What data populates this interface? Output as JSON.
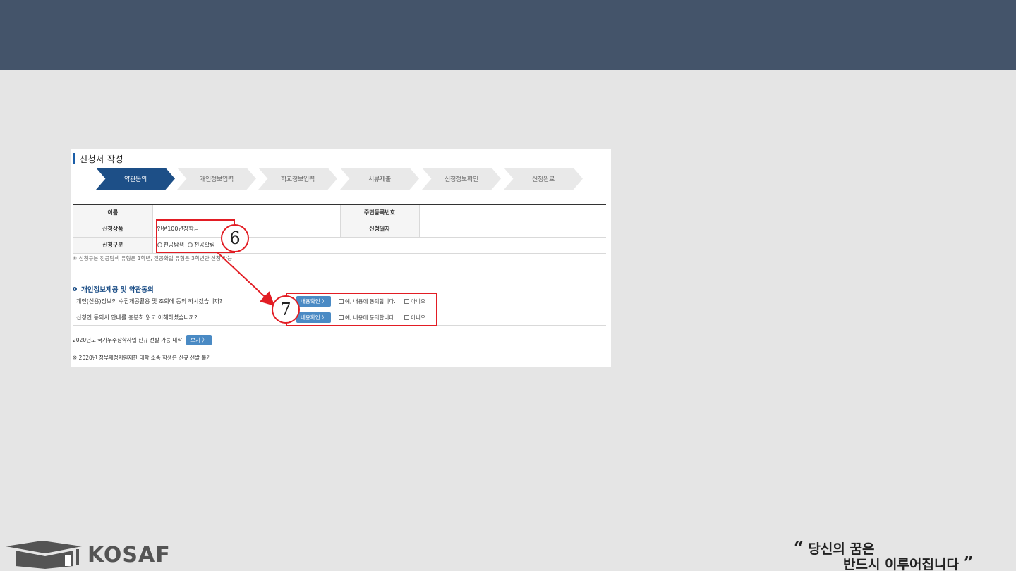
{
  "form": {
    "title": "신청서 작성",
    "steps": [
      "약관동의",
      "개인정보입력",
      "학교정보입력",
      "서류제출",
      "신청정보확인",
      "신청완료"
    ],
    "fields": {
      "name_label": "이름",
      "rrn_label": "주민등록번호",
      "product_label": "신청상품",
      "product_value": "인문100년장학금",
      "date_label": "신청일자",
      "type_label": "신청구분",
      "type_opt1": "전공탐색",
      "type_opt2": "전공확립"
    },
    "type_note": "※ 신청구분 전공탐색 유형은 1학년, 전공확립 유형은 3학년만 신청 가능",
    "consent": {
      "section_title": "개인정보제공 및 약관동의",
      "q1": "개인(신용)정보의 수집제공활용 및 조회에 동의 하시겠습니까?",
      "q2": "신청인 동의서 안내를 충분히 읽고 이해하셨습니까?",
      "view_button": "내용확인 〉",
      "agree_label": "예, 내용에 동의합니다.",
      "disagree_label": "아니오"
    },
    "univ_text": "2020년도 국가우수장학사업 신규 선발 가능 대학",
    "univ_button": "보기 〉",
    "univ_note": "※ 2020년 정부재정지원제한 대학 소속 학생은 신규 선발 불가"
  },
  "annotations": {
    "marker6": "6",
    "marker7": "7",
    "color": "#e21d24"
  },
  "footer": {
    "logo_text": "KOSAF",
    "quote_open": "“",
    "quote_line1": "당신의 꿈은",
    "quote_line2": "반드시 이루어집니다",
    "quote_close": "”"
  },
  "colors": {
    "header_band": "#44546a",
    "active_step": "#1d4f87",
    "background": "#e5e5e5"
  }
}
